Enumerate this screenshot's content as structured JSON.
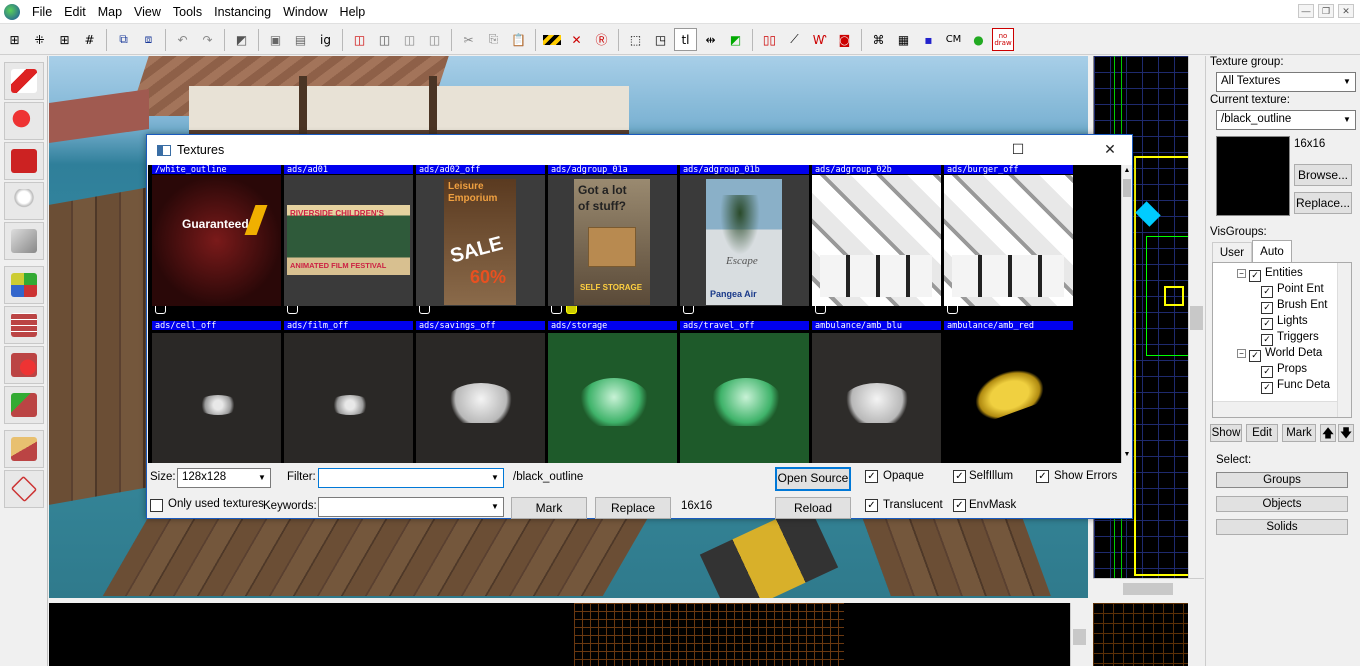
{
  "menubar": {
    "items": [
      "File",
      "Edit",
      "Map",
      "View",
      "Tools",
      "Instancing",
      "Window",
      "Help"
    ]
  },
  "toolbar": {
    "icons": [
      "grid-icon",
      "grid-dots-icon",
      "grid-plus-icon",
      "grid-minus-icon",
      "carve-icon",
      "group-icon",
      "undo-icon",
      "redo-icon",
      "clipper-icon",
      "select-groups-icon",
      "select-objects-icon",
      "select-solids-icon",
      "box-select-icon",
      "toggle-icon",
      "ignore-groups-icon",
      "cordon-icon",
      "cordon-box-icon",
      "cordon-toggle-icon",
      "hollow-icon",
      "scissors-icon",
      "copy-icon",
      "paste-icon",
      "hazard-icon",
      "hazard-x-icon",
      "radius-icon",
      "bounding-box-icon",
      "texture-lock-icon",
      "tl-icon",
      "align-icon",
      "flag-icon",
      "helpers-icon",
      "models-icon",
      "skeleton-icon",
      "decals-icon",
      "mesh-icon",
      "vertex-icon",
      "cube-icon",
      "cm-icon",
      "leaf-icon",
      "no-draw-icon"
    ],
    "ig_label": "ig",
    "tl_label": "tl",
    "cm_label": "CM",
    "nodraw_label": "no draw"
  },
  "texture_dialog": {
    "title": "Textures",
    "row1": [
      {
        "name": "/white_outline"
      },
      {
        "name": "ads/ad01"
      },
      {
        "name": "ads/ad02_off"
      },
      {
        "name": "ads/adgroup_01a"
      },
      {
        "name": "ads/adgroup_01b"
      },
      {
        "name": "ads/adgroup_02b"
      },
      {
        "name": "ads/burger_off"
      }
    ],
    "row2": [
      {
        "name": "ads/cell_off"
      },
      {
        "name": "ads/film_off"
      },
      {
        "name": "ads/savings_off"
      },
      {
        "name": "ads/storage"
      },
      {
        "name": "ads/travel_off"
      },
      {
        "name": "ambulance/amb_blu"
      },
      {
        "name": "ambulance/amb_red"
      }
    ],
    "posters": {
      "guaranteed": "Guaranteed",
      "riverside": "RIVERSIDE CHILDREN'S",
      "animated": "ANIMATED FILM FESTIVAL",
      "leisure1": "Leisure",
      "leisure2": "Emporium",
      "sale": "SALE",
      "sixty": "60%",
      "gotalot1": "Got a lot",
      "gotalot2": "of stuff?",
      "selfstorage": "SELF STORAGE",
      "escape": "Escape",
      "pangea": "Pangea Air"
    },
    "size_label": "Size:",
    "size_value": "128x128",
    "filter_label": "Filter:",
    "filter_value": "",
    "current_name": "/black_outline",
    "current_size": "16x16",
    "only_used_label": "Only used textures",
    "keywords_label": "Keywords:",
    "keywords_value": "",
    "mark_label": "Mark",
    "replace_label": "Replace",
    "open_source_label": "Open Source",
    "reload_label": "Reload",
    "opaque_label": "Opaque",
    "translucent_label": "Translucent",
    "selfillum_label": "SelfIllum",
    "envmask_label": "EnvMask",
    "show_errors_label": "Show Errors"
  },
  "right_panel": {
    "texture_group_label": "Texture group:",
    "texture_group_value": "All Textures",
    "current_texture_label": "Current texture:",
    "current_texture_value": "/black_outline",
    "texture_size": "16x16",
    "browse_label": "Browse...",
    "replace_label": "Replace...",
    "visgroups_label": "VisGroups:",
    "tab_user": "User",
    "tab_auto": "Auto",
    "tree": [
      {
        "label": "Entities",
        "level": 1
      },
      {
        "label": "Point Ent",
        "level": 2
      },
      {
        "label": "Brush Ent",
        "level": 2
      },
      {
        "label": "Lights",
        "level": 2
      },
      {
        "label": "Triggers",
        "level": 2
      },
      {
        "label": "World Deta",
        "level": 1
      },
      {
        "label": "Props",
        "level": 2
      },
      {
        "label": "Func Deta",
        "level": 2
      }
    ],
    "show_label": "Show",
    "edit_label": "Edit",
    "mark_label": "Mark",
    "select_label": "Select:",
    "groups_label": "Groups",
    "objects_label": "Objects",
    "solids_label": "Solids"
  },
  "colors": {
    "title_bar_accent": "#1a5bbf",
    "texture_name_bg": "#0000ee",
    "grid_2d": "#1e2a6e",
    "storage_green": "#1e5a2a"
  }
}
